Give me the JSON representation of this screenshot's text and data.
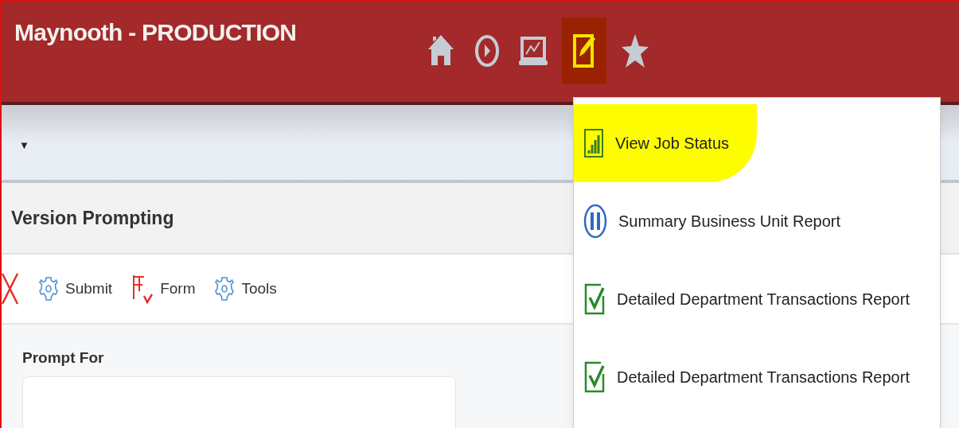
{
  "header": {
    "title": "Maynooth - PRODUCTION",
    "nav_icons": [
      {
        "kind": "home",
        "selected": false
      },
      {
        "kind": "recent",
        "selected": false
      },
      {
        "kind": "monitor",
        "selected": false
      },
      {
        "kind": "edit",
        "selected": true
      },
      {
        "kind": "favorites",
        "selected": false
      }
    ]
  },
  "collapse_toggle": "▼",
  "form": {
    "title": "Version Prompting",
    "toolbar": [
      {
        "kind": "close"
      },
      {
        "kind": "gear",
        "label": "Submit"
      },
      {
        "kind": "form",
        "label": "Form"
      },
      {
        "kind": "gear",
        "label": "Tools"
      }
    ],
    "prompt_label": "Prompt For"
  },
  "menu": {
    "items": [
      {
        "kind": "status",
        "label": "View Job Status",
        "highlighted": true
      },
      {
        "kind": "paused",
        "label": "Summary Business Unit Report",
        "highlighted": false
      },
      {
        "kind": "done",
        "label": "Detailed Department Transactions Report",
        "highlighted": false
      },
      {
        "kind": "done",
        "label": "Detailed Department Transactions Report",
        "highlighted": false
      }
    ]
  }
}
